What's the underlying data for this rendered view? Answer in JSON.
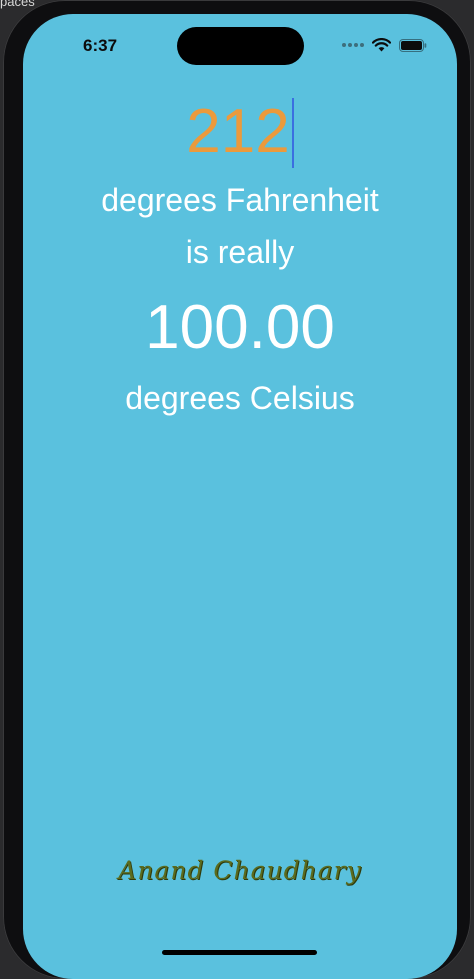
{
  "background": {
    "partial_text": "paces"
  },
  "status_bar": {
    "time": "6:37"
  },
  "converter": {
    "fahrenheit_value": "212",
    "fahrenheit_label": "degrees Fahrenheit",
    "connector": "is really",
    "celsius_value": "100.00",
    "celsius_label": "degrees Celsius"
  },
  "footer": {
    "signature": "Anand Chaudhary"
  },
  "colors": {
    "screen_bg": "#5ac1de",
    "input_text": "#eb9a3c",
    "body_text": "#ffffff",
    "caret": "#3b6fe0"
  },
  "icons": [
    "signal-dots-icon",
    "wifi-icon",
    "battery-icon"
  ]
}
